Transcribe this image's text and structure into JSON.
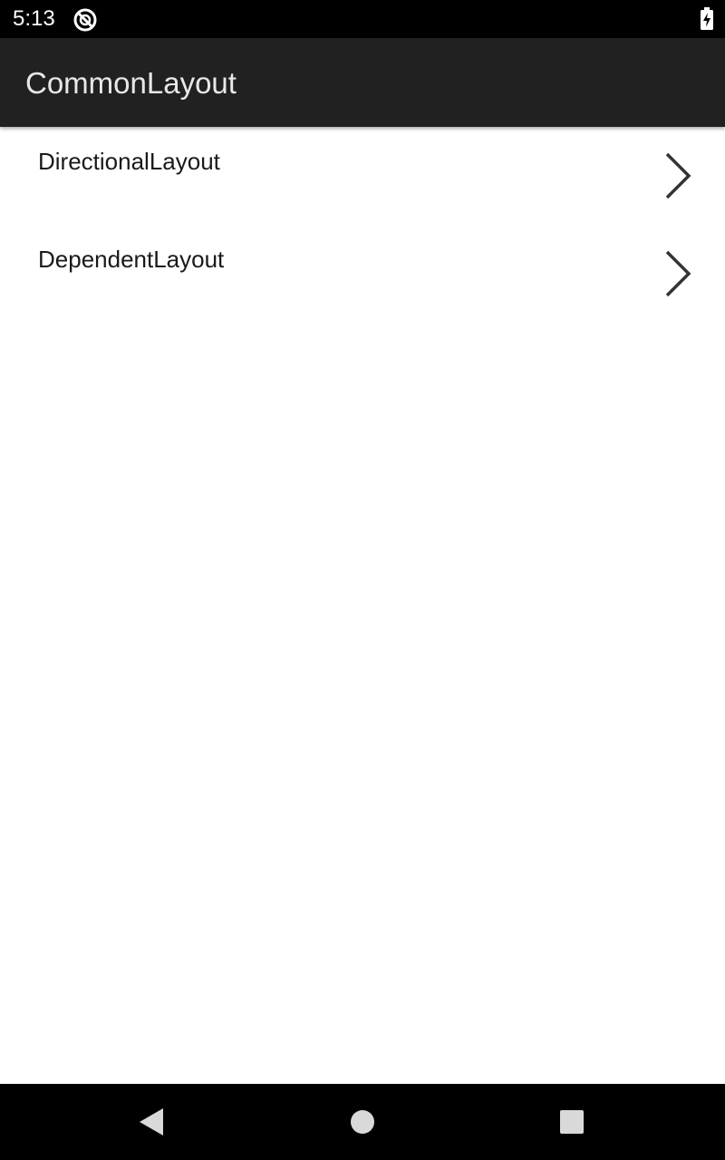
{
  "status_bar": {
    "time": "5:13",
    "notification_icon": "do-not-disturb-icon",
    "battery_icon": "battery-charging-icon"
  },
  "app_bar": {
    "title": "CommonLayout"
  },
  "list": {
    "items": [
      {
        "label": "DirectionalLayout",
        "icon": "chevron-right-icon"
      },
      {
        "label": "DependentLayout",
        "icon": "chevron-right-icon"
      }
    ]
  },
  "nav_bar": {
    "back_icon": "back-triangle-icon",
    "home_icon": "home-circle-icon",
    "recents_icon": "recents-square-icon"
  },
  "colors": {
    "status_bar_bg": "#000000",
    "app_bar_bg": "#212121",
    "app_title": "#e8e8e8",
    "list_text": "#1a1a1a",
    "chevron": "#333333",
    "nav_icons": "#d9d9d9"
  }
}
